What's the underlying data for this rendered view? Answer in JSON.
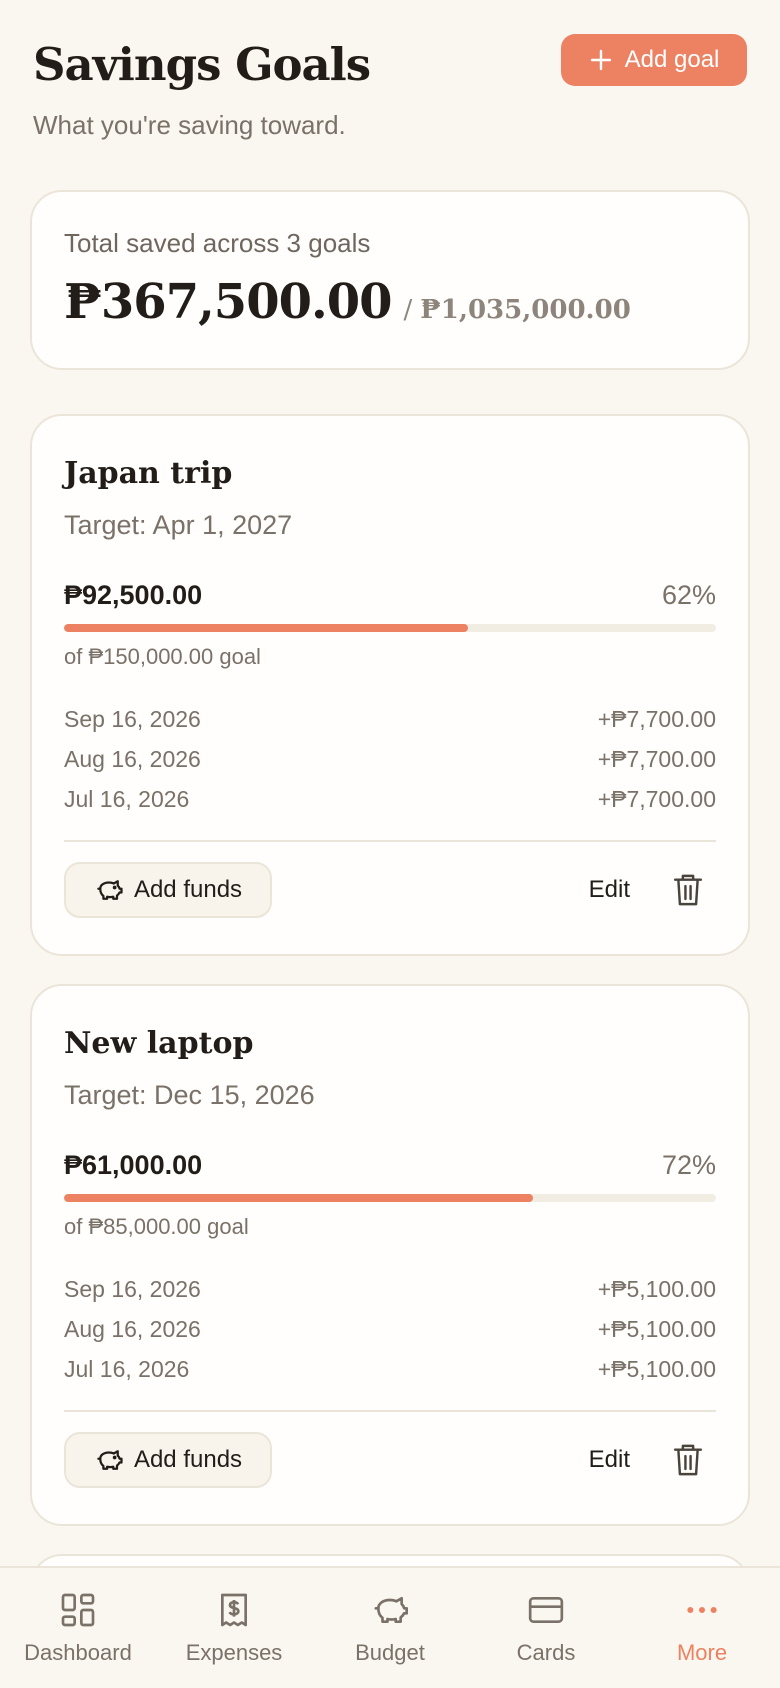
{
  "header": {
    "title": "Savings Goals",
    "subtitle": "What you're saving toward.",
    "add_goal_label": "Add goal"
  },
  "summary": {
    "label": "Total saved across 3 goals",
    "total": "₱367,500.00",
    "separator": "/",
    "target": "₱1,035,000.00"
  },
  "goals": [
    {
      "name": "Japan trip",
      "target_date": "Target: Apr 1, 2027",
      "saved": "₱92,500.00",
      "percent": "62%",
      "progress": 0.62,
      "goal_text": "of ₱150,000.00 goal",
      "history": [
        {
          "date": "Sep 16, 2026",
          "amount": "+₱7,700.00"
        },
        {
          "date": "Aug 16, 2026",
          "amount": "+₱7,700.00"
        },
        {
          "date": "Jul 16, 2026",
          "amount": "+₱7,700.00"
        }
      ],
      "add_funds_label": "Add funds",
      "edit_label": "Edit"
    },
    {
      "name": "New laptop",
      "target_date": "Target: Dec 15, 2026",
      "saved": "₱61,000.00",
      "percent": "72%",
      "progress": 0.72,
      "goal_text": "of ₱85,000.00 goal",
      "history": [
        {
          "date": "Sep 16, 2026",
          "amount": "+₱5,100.00"
        },
        {
          "date": "Aug 16, 2026",
          "amount": "+₱5,100.00"
        },
        {
          "date": "Jul 16, 2026",
          "amount": "+₱5,100.00"
        }
      ],
      "add_funds_label": "Add funds",
      "edit_label": "Edit"
    }
  ],
  "nav": {
    "items": [
      {
        "label": "Dashboard",
        "icon": "dashboard-icon"
      },
      {
        "label": "Expenses",
        "icon": "receipt-icon"
      },
      {
        "label": "Budget",
        "icon": "piggy-bank-icon"
      },
      {
        "label": "Cards",
        "icon": "card-icon"
      },
      {
        "label": "More",
        "icon": "more-icon",
        "active": true
      }
    ]
  },
  "colors": {
    "accent": "#ec8262",
    "background": "#faf7f0",
    "card": "#fffefc",
    "muted_text": "#7a7168"
  }
}
